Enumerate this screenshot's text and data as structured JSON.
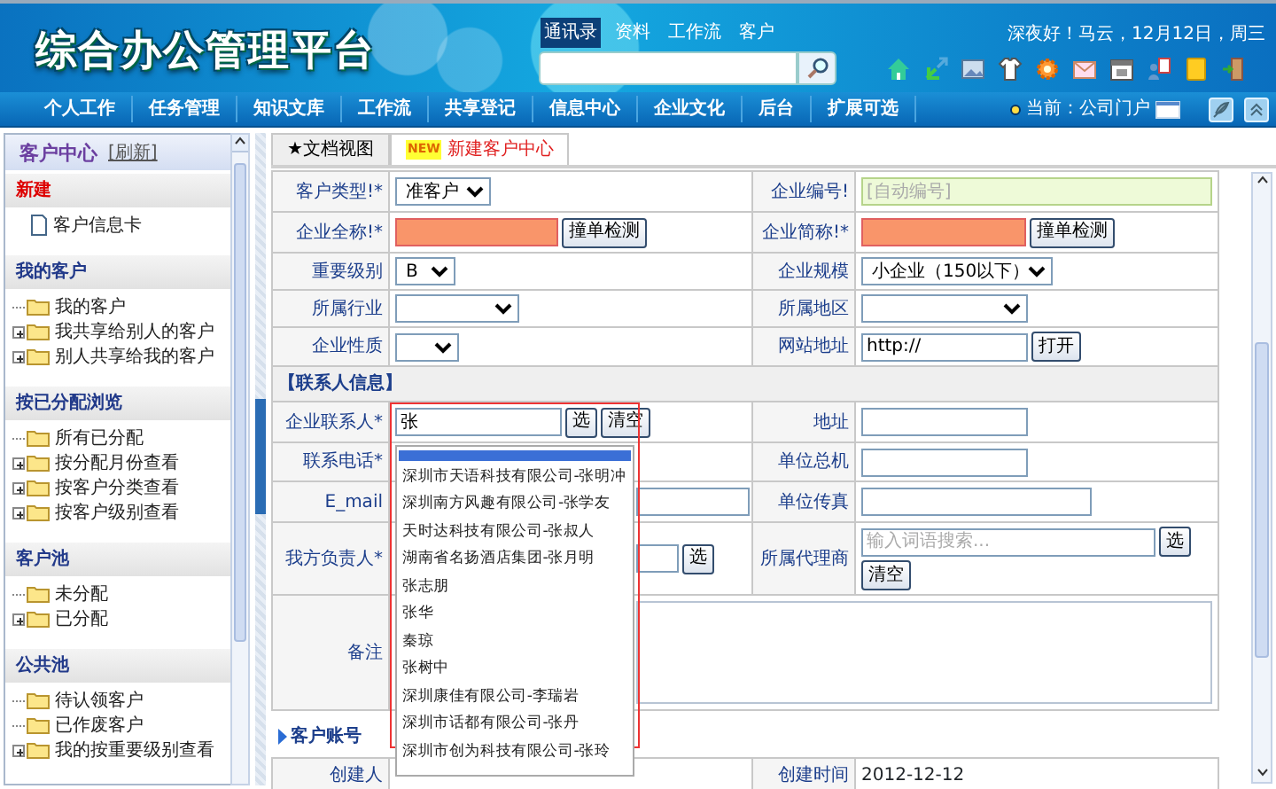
{
  "header": {
    "logo": "综合办公管理平台",
    "top_links": [
      {
        "label": "通讯录",
        "selected": true
      },
      {
        "label": "资料",
        "selected": false
      },
      {
        "label": "工作流",
        "selected": false
      },
      {
        "label": "客户",
        "selected": false
      }
    ],
    "greeting": "深夜好！马云，12月12日，周三"
  },
  "nav": {
    "items": [
      "个人工作",
      "任务管理",
      "知识文库",
      "工作流",
      "共享登记",
      "信息中心",
      "企业文化",
      "后台",
      "扩展可选"
    ],
    "current": "当前：公司门户"
  },
  "sidebar": {
    "title": "客户中心",
    "refresh": "[刷新]",
    "sections": [
      {
        "title": "新建",
        "kind": "new",
        "items": [
          {
            "label": "客户信息卡",
            "kind": "doc",
            "expandable": false
          }
        ]
      },
      {
        "title": "我的客户",
        "kind": "group",
        "items": [
          {
            "label": "我的客户",
            "kind": "folder",
            "expandable": false
          },
          {
            "label": "我共享给别人的客户",
            "kind": "folder",
            "expandable": true
          },
          {
            "label": "别人共享给我的客户",
            "kind": "folder",
            "expandable": true
          }
        ]
      },
      {
        "title": "按已分配浏览",
        "kind": "group",
        "items": [
          {
            "label": "所有已分配",
            "kind": "folder",
            "expandable": false
          },
          {
            "label": "按分配月份查看",
            "kind": "folder",
            "expandable": true
          },
          {
            "label": "按客户分类查看",
            "kind": "folder",
            "expandable": true
          },
          {
            "label": "按客户级别查看",
            "kind": "folder",
            "expandable": true
          }
        ]
      },
      {
        "title": "客户池",
        "kind": "group",
        "items": [
          {
            "label": "未分配",
            "kind": "folder",
            "expandable": false
          },
          {
            "label": "已分配",
            "kind": "folder",
            "expandable": true
          }
        ]
      },
      {
        "title": "公共池",
        "kind": "group",
        "items": [
          {
            "label": "待认领客户",
            "kind": "folder",
            "expandable": false
          },
          {
            "label": "已作废客户",
            "kind": "folder",
            "expandable": false
          },
          {
            "label": "我的按重要级别查看",
            "kind": "folder",
            "expandable": true
          }
        ]
      }
    ]
  },
  "tabs": [
    {
      "label": "★文档视图",
      "selected": false
    },
    {
      "label": "新建客户中心",
      "badge": "NEW",
      "selected": true
    }
  ],
  "form": {
    "rows": [
      {
        "kind": "pair",
        "left": {
          "label": "客户类型!*",
          "control": {
            "kind": "select",
            "value": "准客户"
          }
        },
        "right": {
          "label": "企业编号!",
          "control": {
            "kind": "input",
            "placeholder": "[自动编号]",
            "readonly": true
          }
        }
      },
      {
        "kind": "pair",
        "left": {
          "label": "企业全称!*",
          "control": {
            "kind": "input",
            "invalid": true,
            "buttons": [
              "撞单检测"
            ]
          }
        },
        "right": {
          "label": "企业简称!*",
          "control": {
            "kind": "input",
            "invalid": true,
            "buttons": [
              "撞单检测"
            ]
          }
        }
      },
      {
        "kind": "pair",
        "left": {
          "label": "重要级别",
          "control": {
            "kind": "select",
            "value": "B"
          }
        },
        "right": {
          "label": "企业规模",
          "control": {
            "kind": "select",
            "value": "小企业（150以下）"
          }
        }
      },
      {
        "kind": "pair",
        "left": {
          "label": "所属行业",
          "control": {
            "kind": "select"
          }
        },
        "right": {
          "label": "所属地区",
          "control": {
            "kind": "select"
          }
        }
      },
      {
        "kind": "pair",
        "left": {
          "label": "企业性质",
          "control": {
            "kind": "select"
          }
        },
        "right": {
          "label": "网站地址",
          "control": {
            "kind": "input",
            "value": "http://",
            "buttons": [
              "打开"
            ]
          }
        }
      },
      {
        "kind": "section",
        "title": "【联系人信息】"
      },
      {
        "kind": "pair",
        "left": {
          "label": "企业联系人*",
          "control": {
            "kind": "input",
            "value": "张",
            "buttons": [
              "选",
              "清空"
            ]
          }
        },
        "right": {
          "label": "地址",
          "control": {
            "kind": "input"
          }
        }
      },
      {
        "kind": "pair",
        "left": {
          "label": "联系电话*"
        },
        "right": {
          "label": "单位总机",
          "control": {
            "kind": "input"
          }
        }
      },
      {
        "kind": "pair",
        "left": {
          "label": "E_mail",
          "control": {
            "kind": "input"
          }
        },
        "right": {
          "label": "单位传真",
          "control": {
            "kind": "input"
          }
        }
      },
      {
        "kind": "pair",
        "left": {
          "label": "我方负责人*",
          "control": {
            "kind": "input",
            "buttons": [
              "选"
            ]
          }
        },
        "right": {
          "label": "所属代理商",
          "control": {
            "kind": "input",
            "placeholder": "输入词语搜索...",
            "buttons": [
              "选",
              "清空"
            ]
          }
        }
      },
      {
        "kind": "wide",
        "label": "备注",
        "control": {
          "kind": "textarea"
        }
      }
    ]
  },
  "links": [
    "客户账号"
  ],
  "footer_row": [
    {
      "label": "创建人"
    },
    {
      "label": "创建时间",
      "value": "2012-12-12"
    }
  ],
  "autocomplete": {
    "items": [
      {
        "selected": true
      },
      {
        "label": "深圳市天语科技有限公司-张明冲",
        "selected": false
      },
      {
        "label": "深圳南方风趣有限公司-张学友",
        "selected": false
      },
      {
        "label": "天时达科技有限公司-张叔人",
        "selected": false
      },
      {
        "label": "湖南省名扬酒店集团-张月明",
        "selected": false
      },
      {
        "label": "张志朋",
        "selected": false
      },
      {
        "label": "张华",
        "selected": false
      },
      {
        "label": "秦琼",
        "selected": false
      },
      {
        "label": "张树中",
        "selected": false
      },
      {
        "label": "深圳康佳有限公司-李瑞岩",
        "selected": false
      },
      {
        "label": "深圳市话都有限公司-张丹",
        "selected": false
      },
      {
        "label": "深圳市创为科技有限公司-张玲",
        "selected": false
      }
    ]
  }
}
